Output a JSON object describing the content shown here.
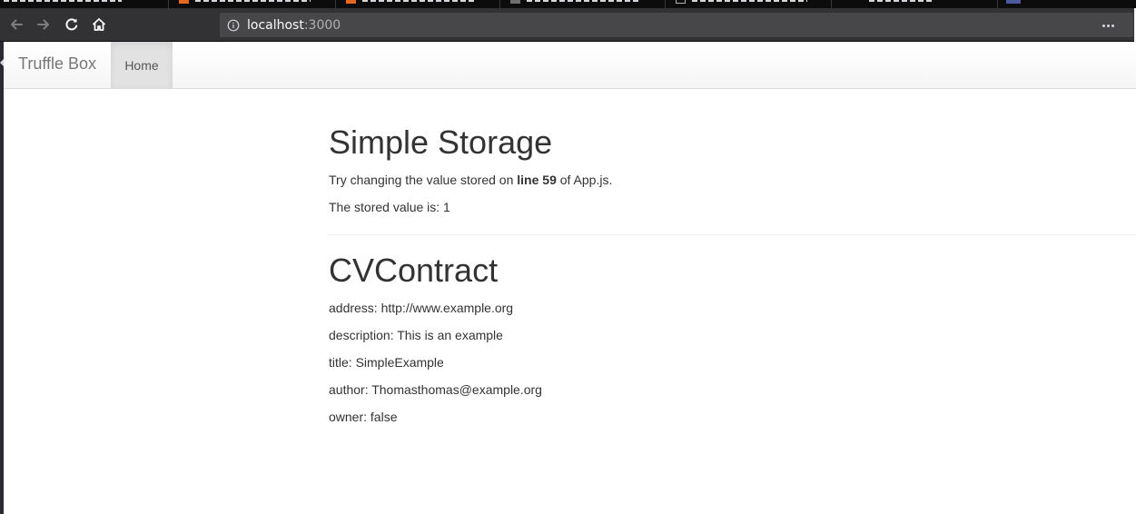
{
  "browser": {
    "url_host": "localhost",
    "url_port": ":3000"
  },
  "icons": {
    "back": "arrow-left-icon",
    "forward": "arrow-right-icon",
    "reload": "reload-icon",
    "home": "home-icon",
    "info": "info-icon",
    "more": "more-dots-icon"
  },
  "app": {
    "brand": "Truffle Box",
    "nav": {
      "home_label": "Home"
    }
  },
  "simple_storage": {
    "heading": "Simple Storage",
    "instruction_prefix": "Try changing the value stored on ",
    "instruction_bold": "line 59",
    "instruction_suffix": " of App.js.",
    "stored_value_text": "The stored value is: 1"
  },
  "cv_contract": {
    "heading": "CVContract",
    "address": "address: http://www.example.org",
    "description": "description: This is an example",
    "title": "title: SimpleExample",
    "author": "author: Thomasthomas@example.org",
    "owner": "owner: false"
  },
  "colors": {
    "chrome_dark": "#0c0c0d",
    "toolbar": "#323234",
    "urlbar": "#474749",
    "nav_active": "#e2e2e2",
    "text": "#333333",
    "brand_text": "#777777"
  }
}
